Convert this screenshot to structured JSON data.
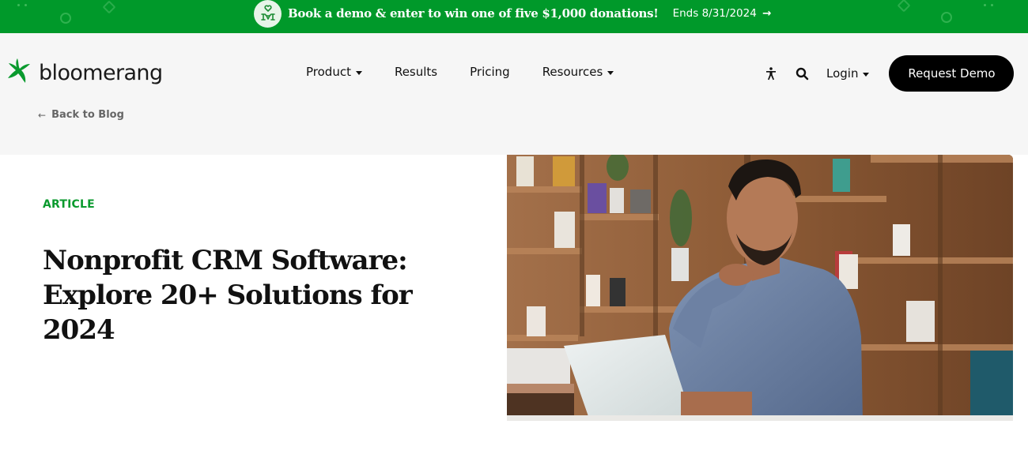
{
  "promo_banner": {
    "icon": "heart-hands-icon",
    "text": "Book a demo & enter to win one of five $1,000 donations!",
    "ends_text": "Ends 8/31/2024",
    "arrow_icon": "arrow-right-icon",
    "background_color": "#00992a"
  },
  "header": {
    "logo": {
      "icon": "bloomerang-star-icon",
      "wordmark": "bloomerang",
      "color": "#0a9a2e"
    },
    "nav": [
      {
        "label": "Product",
        "has_dropdown": true
      },
      {
        "label": "Results",
        "has_dropdown": false
      },
      {
        "label": "Pricing",
        "has_dropdown": false
      },
      {
        "label": "Resources",
        "has_dropdown": true
      }
    ],
    "accessibility_icon": "accessibility-icon",
    "search_icon": "search-icon",
    "login": {
      "label": "Login",
      "has_dropdown": true
    },
    "cta": {
      "label": "Request Demo"
    },
    "back_link": {
      "label": "Back to Blog",
      "icon": "arrow-left-icon"
    }
  },
  "hero": {
    "eyebrow": "ARTICLE",
    "title": "Nonprofit CRM Software: Explore 20+ Solutions for 2024",
    "image": {
      "description": "Bearded man in blue shirt smiling at a laptop in an office with wooden shelves",
      "icon": "hero-photo"
    },
    "accent_color": "#0a9a2e"
  }
}
